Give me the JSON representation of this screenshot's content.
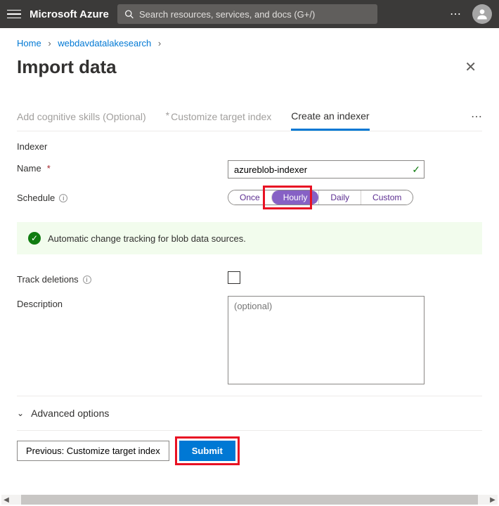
{
  "topbar": {
    "brand": "Microsoft Azure",
    "search_placeholder": "Search resources, services, and docs (G+/)"
  },
  "breadcrumb": {
    "home": "Home",
    "current": "webdavdatalakesearch"
  },
  "page": {
    "title": "Import data"
  },
  "tabs": {
    "cognitive": "Add cognitive skills (Optional)",
    "customize": "Customize target index",
    "indexer": "Create an indexer"
  },
  "form": {
    "section": "Indexer",
    "name_label": "Name",
    "name_value": "azureblob-indexer",
    "schedule_label": "Schedule",
    "schedule_options": {
      "once": "Once",
      "hourly": "Hourly",
      "daily": "Daily",
      "custom": "Custom"
    },
    "banner": "Automatic change tracking for blob data sources.",
    "track_deletions_label": "Track deletions",
    "description_label": "Description",
    "description_placeholder": "(optional)",
    "advanced": "Advanced options"
  },
  "footer": {
    "previous": "Previous: Customize target index",
    "submit": "Submit"
  }
}
